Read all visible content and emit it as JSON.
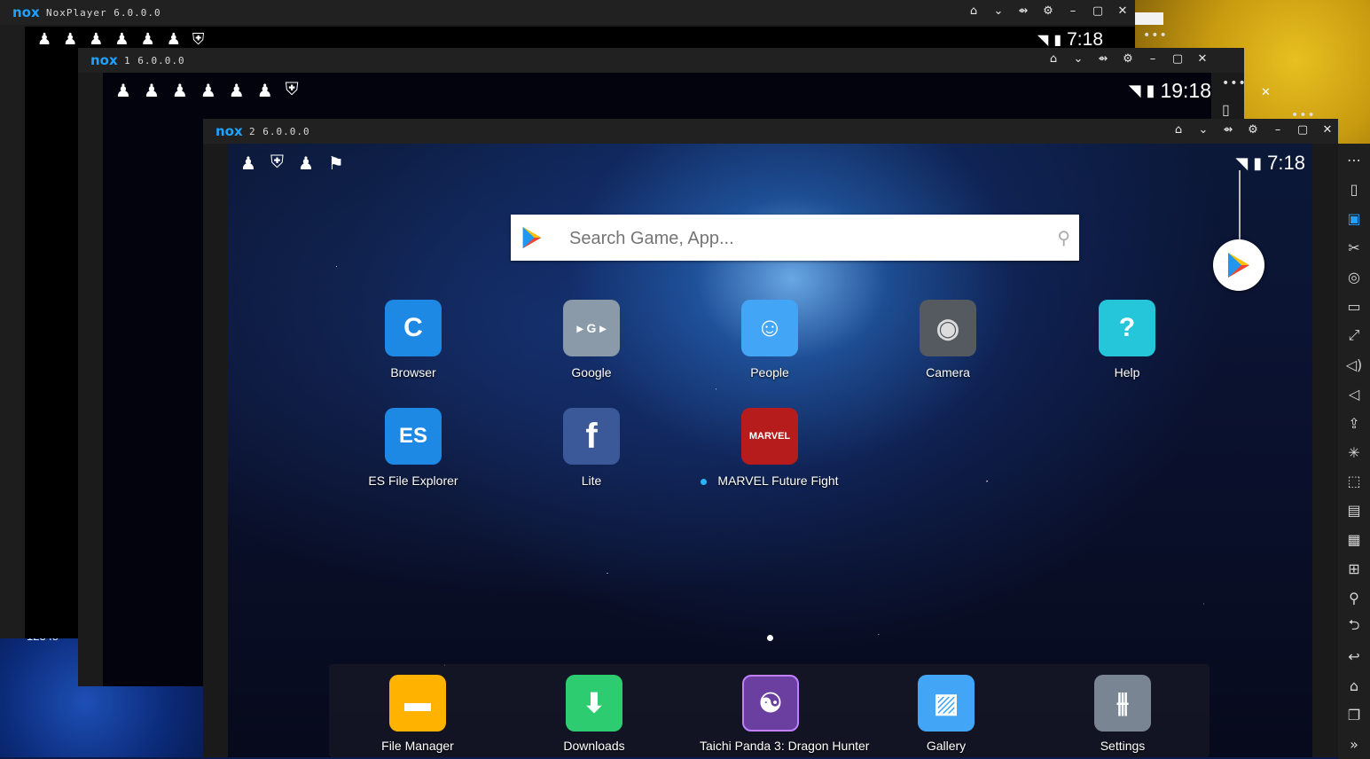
{
  "windows": [
    {
      "title": "NoxPlayer 6.0.0.0",
      "clock": "7:18",
      "status_icons": [
        "keyhole-icon",
        "keyhole-icon",
        "keyhole-icon",
        "keyhole-icon",
        "keyhole-icon",
        "keyhole-icon",
        "shield-icon"
      ]
    },
    {
      "title": "1 6.0.0.0",
      "clock": "19:18",
      "status_icons": [
        "keyhole-icon",
        "keyhole-icon",
        "keyhole-icon",
        "keyhole-icon",
        "keyhole-icon",
        "keyhole-icon",
        "shield-icon"
      ]
    },
    {
      "title": "2 6.0.0.0",
      "clock": "7:18",
      "status_icons": [
        "keyhole-icon",
        "shield-icon",
        "keyhole-icon",
        "check-flag-icon"
      ]
    }
  ],
  "logo_text": "nox",
  "titlebar_controls": [
    "home-icon",
    "chevron-down-icon",
    "pin-icon",
    "gear-icon",
    "minimize-icon",
    "maximize-icon",
    "close-icon"
  ],
  "background_text": "12345",
  "search": {
    "placeholder": "Search Game, App..."
  },
  "apps_grid": [
    {
      "label": "Browser",
      "icon": "browser-icon",
      "color": "#1e88e5"
    },
    {
      "label": "Google",
      "icon": "google-folder-icon",
      "color": "#8a9aa8"
    },
    {
      "label": "People",
      "icon": "people-icon",
      "color": "#42a5f5"
    },
    {
      "label": "Camera",
      "icon": "camera-icon",
      "color": "#555a60"
    },
    {
      "label": "Help",
      "icon": "help-icon",
      "color": "#26c6da"
    },
    {
      "label": "ES File Explorer",
      "icon": "es-file-explorer-icon",
      "color": "#1e88e5"
    },
    {
      "label": "Lite",
      "icon": "facebook-icon",
      "color": "#3b5998"
    },
    {
      "label": "MARVEL Future Fight",
      "icon": "marvel-icon",
      "color": "#b71c1c"
    }
  ],
  "dock": [
    {
      "label": "File Manager",
      "icon": "folder-icon",
      "color": "#ffb300"
    },
    {
      "label": "Downloads",
      "icon": "download-icon",
      "color": "#2ecc71"
    },
    {
      "label": "Taichi Panda 3: Dragon Hunter",
      "icon": "taichi-panda-icon",
      "color": "#6a3fa0"
    },
    {
      "label": "Gallery",
      "icon": "gallery-icon",
      "color": "#42a5f5"
    },
    {
      "label": "Settings",
      "icon": "settings-icon",
      "color": "#7a8594"
    }
  ],
  "sidebar_tools": [
    {
      "name": "more-icon",
      "glyph": "⋯"
    },
    {
      "name": "shake-icon",
      "glyph": "▯"
    },
    {
      "name": "robot-icon",
      "glyph": "▣",
      "active": true
    },
    {
      "name": "scissors-icon",
      "glyph": "✂"
    },
    {
      "name": "location-icon",
      "glyph": "◎"
    },
    {
      "name": "keyboard-icon",
      "glyph": "▭"
    },
    {
      "name": "fullscreen-icon",
      "glyph": "⤢"
    },
    {
      "name": "volume-up-icon",
      "glyph": "◁)"
    },
    {
      "name": "volume-down-icon",
      "glyph": "◁"
    },
    {
      "name": "apk-install-icon",
      "glyph": "⇪"
    },
    {
      "name": "loading-icon",
      "glyph": "✳"
    },
    {
      "name": "screenshot-icon",
      "glyph": "⬚"
    },
    {
      "name": "video-record-icon",
      "glyph": "▤"
    },
    {
      "name": "multi-instance-icon",
      "glyph": "▦"
    },
    {
      "name": "macro-icon",
      "glyph": "⊞"
    },
    {
      "name": "link-icon",
      "glyph": "⚲"
    },
    {
      "name": "rotate-icon",
      "glyph": "⮌"
    },
    {
      "name": "back-icon",
      "glyph": "↩"
    },
    {
      "name": "home-nav-icon",
      "glyph": "⌂"
    },
    {
      "name": "recent-apps-icon",
      "glyph": "❐"
    },
    {
      "name": "expand-icon",
      "glyph": "»"
    }
  ]
}
